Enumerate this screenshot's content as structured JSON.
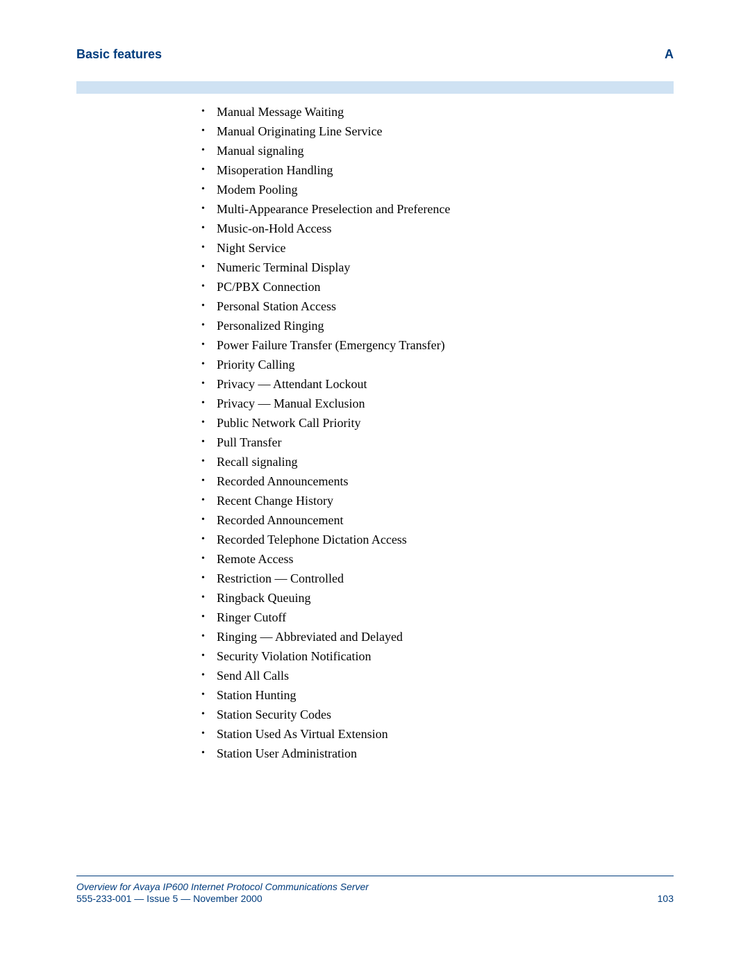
{
  "header": {
    "title": "Basic features",
    "appendix": "A"
  },
  "features": [
    "Manual Message Waiting",
    "Manual Originating Line Service",
    "Manual signaling",
    "Misoperation Handling",
    "Modem Pooling",
    "Multi-Appearance Preselection and Preference",
    "Music-on-Hold Access",
    "Night Service",
    "Numeric Terminal Display",
    "PC/PBX Connection",
    "Personal Station Access",
    "Personalized Ringing",
    "Power Failure Transfer (Emergency Transfer)",
    "Priority Calling",
    "Privacy — Attendant Lockout",
    "Privacy — Manual Exclusion",
    "Public Network Call Priority",
    "Pull Transfer",
    "Recall signaling",
    "Recorded Announcements",
    "Recent Change History",
    "Recorded Announcement",
    "Recorded Telephone Dictation Access",
    "Remote Access",
    "Restriction — Controlled",
    "Ringback Queuing",
    "Ringer Cutoff",
    "Ringing — Abbreviated and Delayed",
    "Security Violation Notification",
    "Send All Calls",
    "Station Hunting",
    "Station Security Codes",
    "Station Used As Virtual Extension",
    "Station User Administration"
  ],
  "footer": {
    "doc_title": "Overview for Avaya IP600 Internet Protocol Communications Server",
    "doc_id_line": "555-233-001 — Issue 5 — November 2000",
    "page_number": "103"
  }
}
